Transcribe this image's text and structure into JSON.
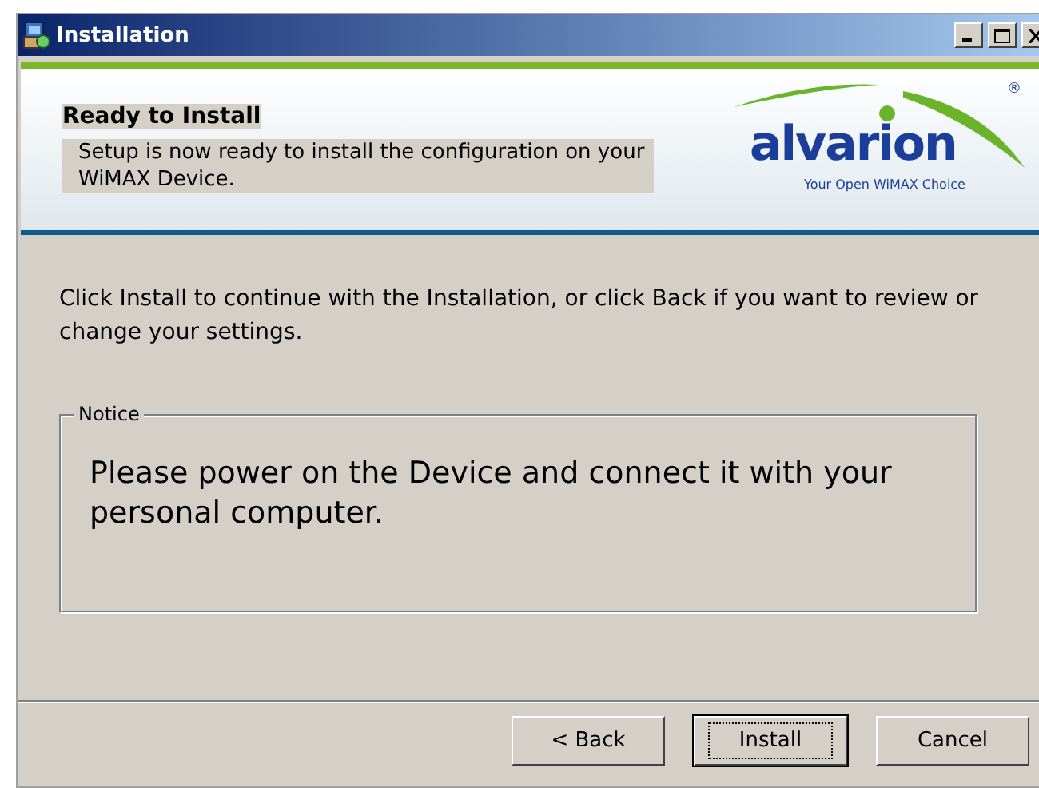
{
  "window": {
    "title": "Installation"
  },
  "header": {
    "title": "Ready to Install",
    "description": "Setup is now ready to install the configuration on your WiMAX Device.",
    "logo": {
      "name": "alvarion",
      "registered": "®",
      "tagline": "Your Open WiMAX Choice"
    }
  },
  "body": {
    "message": "Click Install to continue with the Installation, or click Back if you want to review or change your settings.",
    "notice": {
      "label": "Notice",
      "text": "Please power on the Device and connect it with your personal computer."
    }
  },
  "buttons": [
    {
      "label": "< Back",
      "default": false
    },
    {
      "label": "Install",
      "default": true
    },
    {
      "label": "Cancel",
      "default": false
    }
  ]
}
